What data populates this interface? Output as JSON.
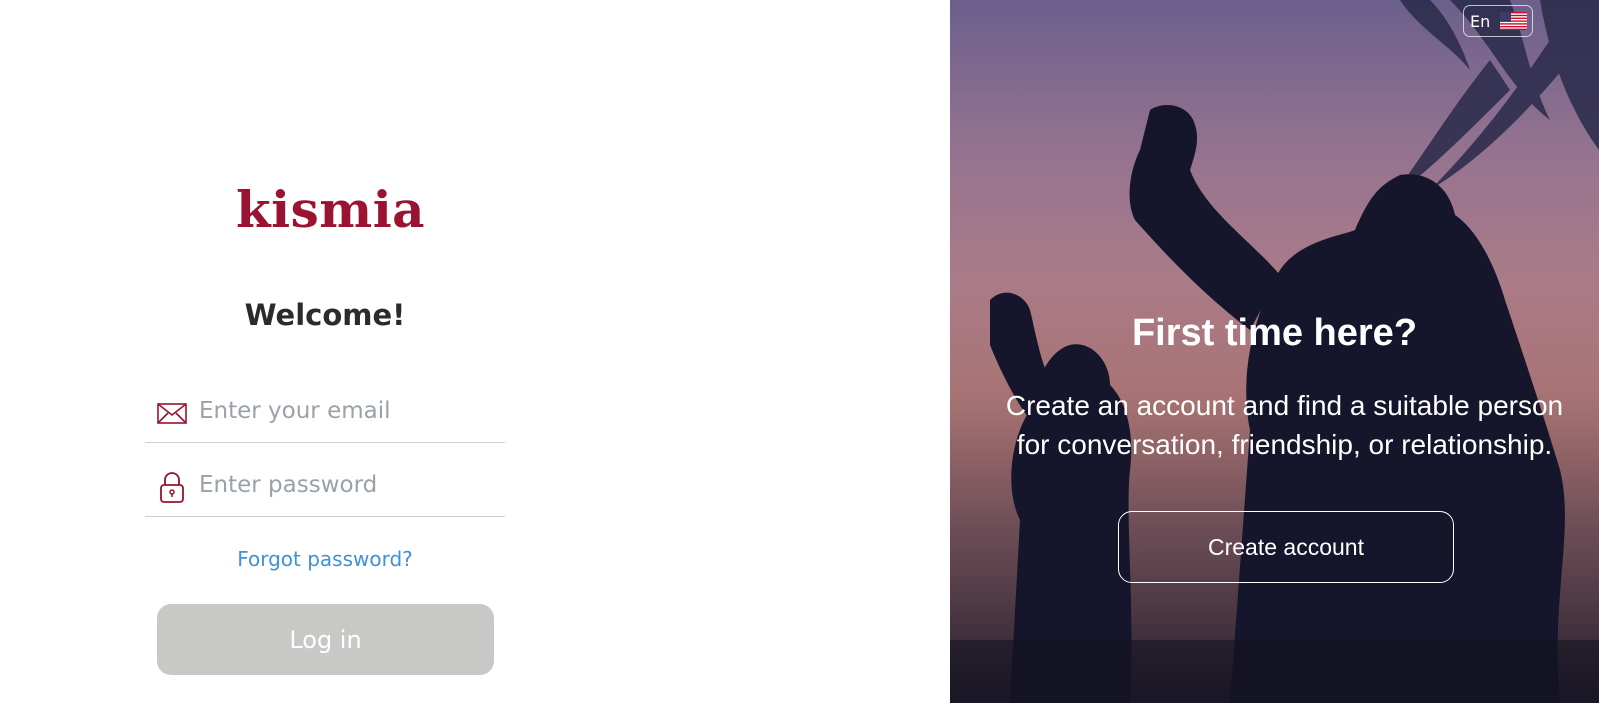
{
  "brand": {
    "logo_text": "kismia",
    "color": "#9a1330"
  },
  "login": {
    "heading": "Welcome!",
    "email_placeholder": "Enter your email",
    "email_icon": "envelope-icon",
    "password_placeholder": "Enter password",
    "password_icon": "lock-icon",
    "forgot_label": "Forgot password?",
    "login_label": "Log in"
  },
  "signup": {
    "language_code": "En",
    "language_flag": "us-flag-icon",
    "heading": "First time here?",
    "description_line1": "Create an account and find a suitable person",
    "description_line2": "for conversation, friendship, or relationship.",
    "create_label": "Create account"
  },
  "colors": {
    "link": "#3d91d8",
    "login_button_bg": "#c8c8c6",
    "text_dark": "#2b2b2b",
    "placeholder": "#9aa1a9"
  }
}
